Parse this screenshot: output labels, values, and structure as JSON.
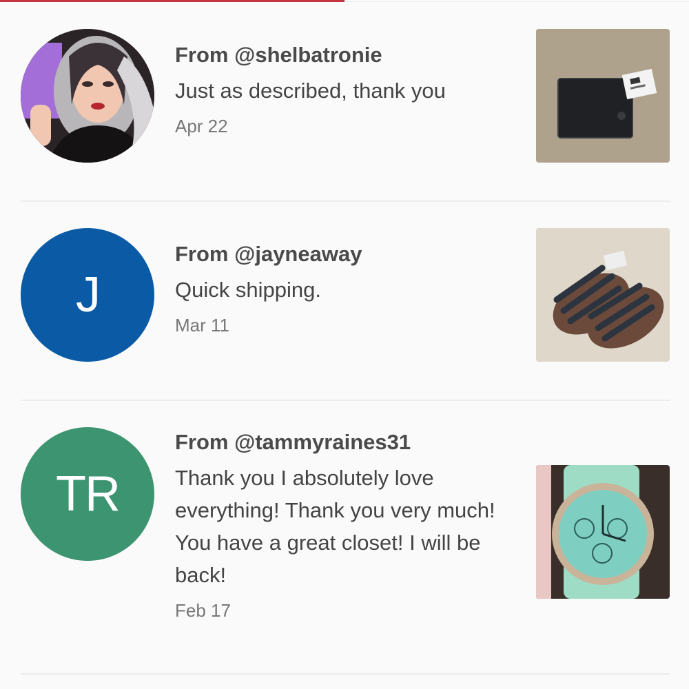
{
  "reviews": [
    {
      "from": "From @shelbatronie",
      "comment": "Just as described, thank you",
      "date": "Apr 22",
      "avatar_type": "photo",
      "thumb_icon": "wallet-photo"
    },
    {
      "from": "From @jayneaway",
      "comment": "Quick shipping.",
      "date": "Mar 11",
      "avatar_initials": "J",
      "avatar_color": "#0a5aa6",
      "thumb_icon": "sandals-photo"
    },
    {
      "from": "From @tammyraines31",
      "comment": "Thank you I absolutely love everything! Thank you very much! You have a great closet! I will be back!",
      "date": "Feb 17",
      "avatar_initials": "TR",
      "avatar_color": "#3d9470",
      "thumb_icon": "watch-photo"
    }
  ],
  "colors": {
    "accent": "#c53541",
    "background": "#fafafa",
    "divider": "#ececec"
  }
}
